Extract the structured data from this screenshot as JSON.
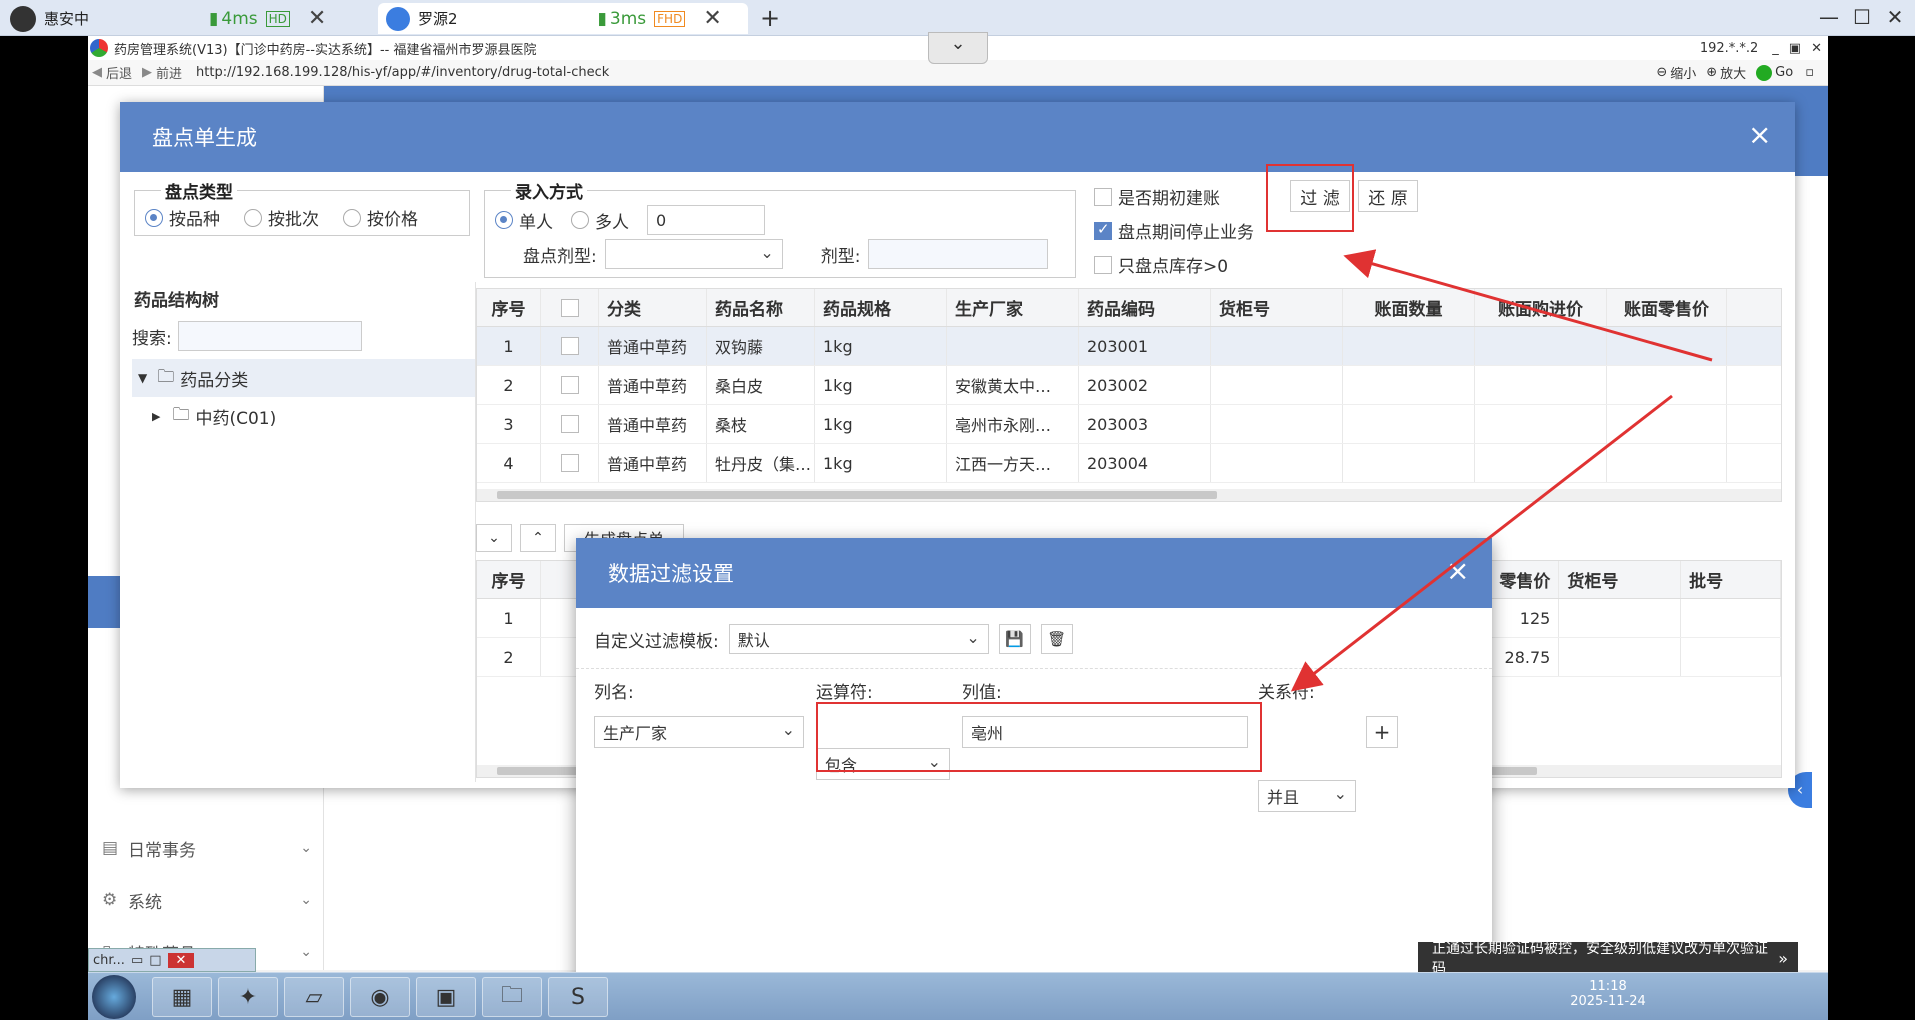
{
  "remote_tabs": [
    {
      "name": "惠安中",
      "ping": "4ms",
      "quality": "HD"
    },
    {
      "name": "罗源2",
      "ping": "3ms",
      "quality": "FHD"
    }
  ],
  "browser": {
    "title": "药房管理系统(V13)【门诊中药房--实达系统】-- 福建省福州市罗源县医院",
    "ip": "192.*.*.2",
    "back": "后退",
    "forward": "前进",
    "url": "http://192.168.199.128/his-yf/app/#/inventory/drug-total-check",
    "zoom_out": "缩小",
    "zoom_in": "放大",
    "go": "Go"
  },
  "sidebar": {
    "items": [
      {
        "label": "日常事务"
      },
      {
        "label": "系统"
      },
      {
        "label": "特殊药品"
      }
    ]
  },
  "dialog_main": {
    "title": "盘点单生成",
    "check_type": {
      "legend": "盘点类型",
      "options": [
        "按品种",
        "按批次",
        "按价格"
      ],
      "selected": "按品种"
    },
    "entry_mode": {
      "legend": "录入方式",
      "options": [
        "单人",
        "多人"
      ],
      "selected": "单人",
      "count": "0",
      "dosage_label": "盘点剂型:",
      "form_label": "剂型:"
    },
    "checks": [
      {
        "label": "是否期初建账",
        "checked": false
      },
      {
        "label": "盘点期间停止业务",
        "checked": true
      },
      {
        "label": "只盘点库存>0",
        "checked": false
      }
    ],
    "filter_btn": "过 滤",
    "restore_btn": "还 原",
    "tree": {
      "title": "药品结构树",
      "search_label": "搜索:",
      "root": "药品分类",
      "child": "中药(C01)"
    },
    "upper_table": {
      "columns": [
        "序号",
        "",
        "分类",
        "药品名称",
        "药品规格",
        "生产厂家",
        "药品编码",
        "货柜号",
        "账面数量",
        "账面购进价",
        "账面零售价"
      ],
      "rows": [
        [
          "1",
          "",
          "普通中草药",
          "双钩藤",
          "1kg",
          "",
          "203001",
          "",
          "",
          "",
          ""
        ],
        [
          "2",
          "",
          "普通中草药",
          "桑白皮",
          "1kg",
          "安徽黄太中…",
          "203002",
          "",
          "",
          "",
          ""
        ],
        [
          "3",
          "",
          "普通中草药",
          "桑枝",
          "1kg",
          "亳州市永刚…",
          "203003",
          "",
          "",
          "",
          ""
        ],
        [
          "4",
          "",
          "普通中草药",
          "牡丹皮（集…",
          "1kg",
          "江西一方天…",
          "203004",
          "",
          "",
          "",
          ""
        ]
      ]
    },
    "generate_btn": "生成盘点单",
    "lower_table": {
      "columns": [
        "序号",
        "零售价",
        "货柜号",
        "批号"
      ],
      "rows": [
        [
          "1",
          "125",
          "",
          ""
        ],
        [
          "2",
          "28.75",
          "",
          ""
        ]
      ]
    }
  },
  "dialog_filter": {
    "title": "数据过滤设置",
    "template_label": "自定义过滤模板:",
    "template_value": "默认",
    "col_label": "列名:",
    "op_label": "运算符:",
    "val_label": "列值:",
    "rel_label": "关系符:",
    "col_value": "生产厂家",
    "op_value": "包含",
    "val_value": "亳州",
    "rel_value": "并且",
    "add": "+"
  },
  "toast": "正通过长期验证码被控，安全级别低建议改为单次验证码",
  "clock": {
    "time": "11:18",
    "date": "2025-11-24"
  },
  "tray_window": "chr..."
}
